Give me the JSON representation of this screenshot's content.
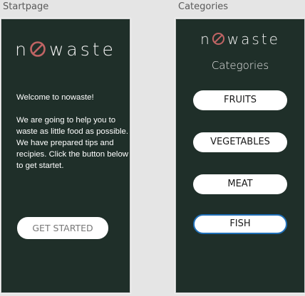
{
  "frames": {
    "start_label": "Startpage",
    "categories_label": "Categories"
  },
  "logo": {
    "prefix": "n",
    "suffix": "waste",
    "icon": "no-entry-icon",
    "icon_color": "#c06464"
  },
  "startpage": {
    "welcome": "Welcome to nowaste!",
    "line1": "We are going to help you to waste as little food as possible.",
    "line2": "We have prepared tips and recipies. Click the button below to get startet.",
    "button": "GET STARTED"
  },
  "categories": {
    "title": "Categories",
    "items": [
      {
        "label": "FRUITS"
      },
      {
        "label": "VEGETABLES"
      },
      {
        "label": "MEAT"
      },
      {
        "label": "FISH",
        "selected": true
      }
    ]
  },
  "colors": {
    "artboard_bg": "#1f2f29",
    "canvas_bg": "#e5e5e5",
    "selected_border": "#1f6fb8"
  }
}
